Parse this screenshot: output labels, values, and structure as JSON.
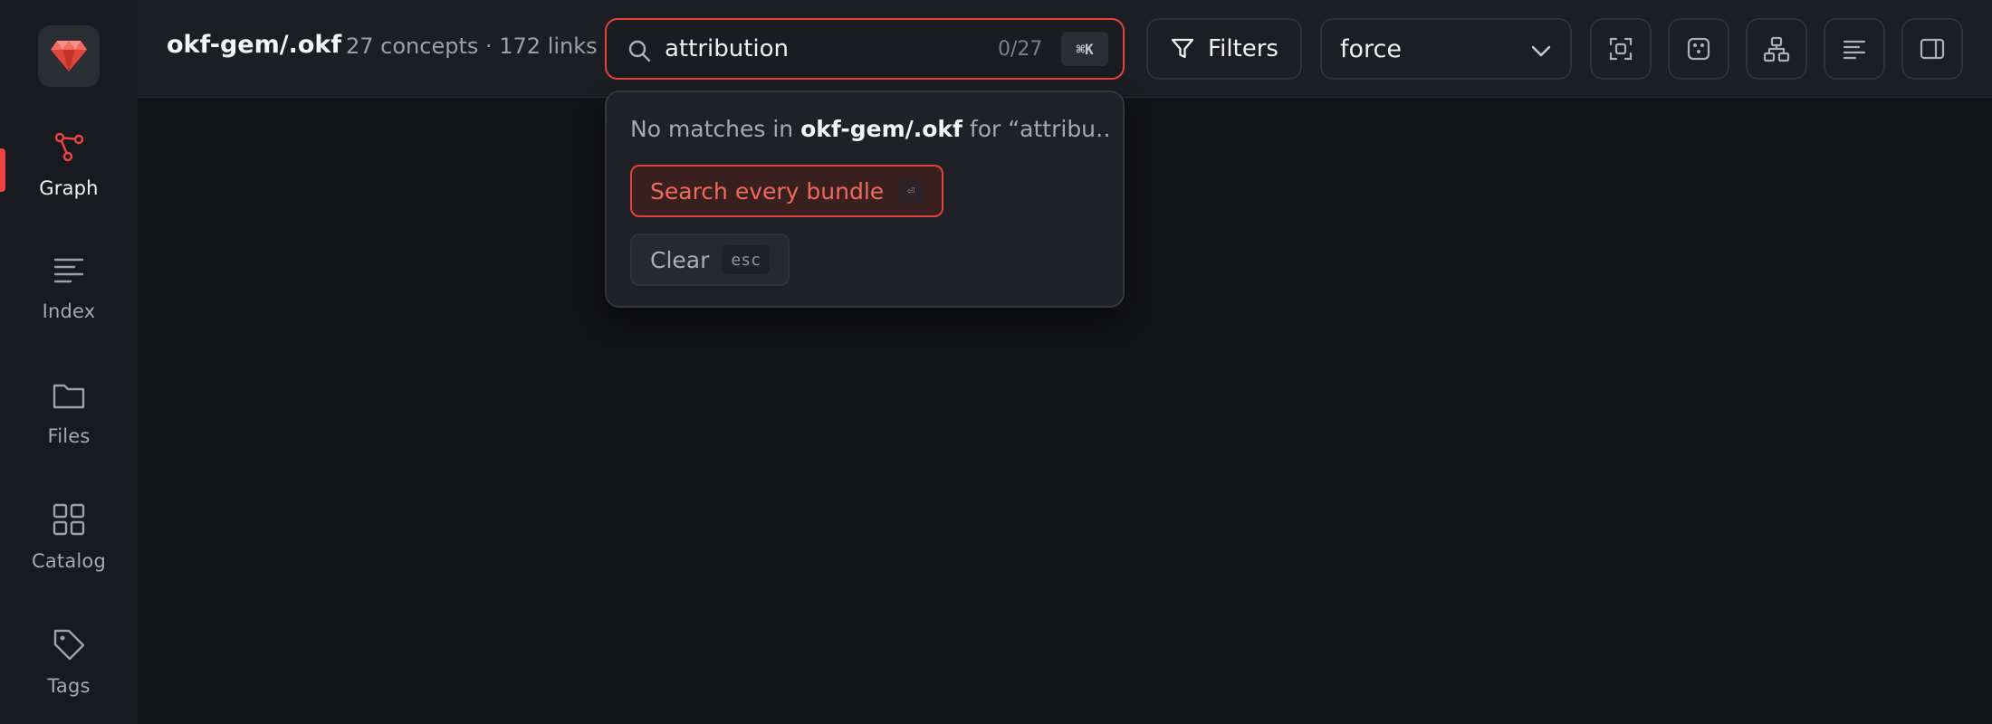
{
  "sidebar": {
    "logo_icon": "gem-icon",
    "items": [
      {
        "label": "Graph",
        "icon": "graph-icon",
        "active": true
      },
      {
        "label": "Index",
        "icon": "list-icon",
        "active": false
      },
      {
        "label": "Files",
        "icon": "folder-icon",
        "active": false
      },
      {
        "label": "Catalog",
        "icon": "grid-icon",
        "active": false
      },
      {
        "label": "Tags",
        "icon": "tag-icon",
        "active": false
      }
    ]
  },
  "topbar": {
    "bundle_name": "okf-gem/.okf",
    "stats": "27 concepts · 172 links",
    "search": {
      "value": "attribution",
      "count": "0/27",
      "shortcut": "⌘K"
    },
    "filters_label": "Filters",
    "layout_select": {
      "value": "force"
    },
    "icon_buttons": [
      "focus-frame-icon",
      "random-layout-icon",
      "hierarchy-icon",
      "text-align-icon",
      "side-panel-icon"
    ]
  },
  "dropdown": {
    "message_prefix": "No matches in",
    "message_bundle": "okf-gem/.okf",
    "message_suffix": "for “attribu…",
    "search_all_label": "Search every bundle",
    "search_all_key": "⏎",
    "clear_label": "Clear",
    "clear_key": "esc"
  },
  "colors": {
    "accent": "#e0453a",
    "background": "#121317",
    "sidebar": "#181a1f"
  }
}
